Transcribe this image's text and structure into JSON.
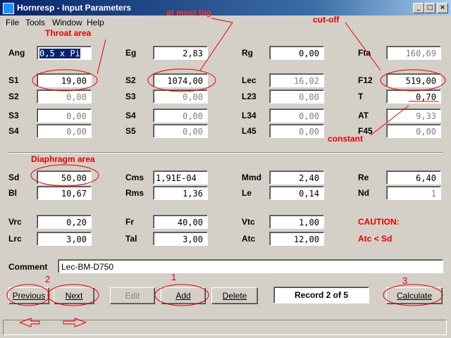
{
  "window": {
    "title": "Hornresp - Input Parameters",
    "controls": [
      "_",
      "□",
      "×"
    ]
  },
  "menu": [
    "File",
    "Tools",
    "Window",
    "Help"
  ],
  "fields": {
    "Ang": "0,5 x Pi",
    "Eg": "2,83",
    "Rg": "0,00",
    "Fta": "160,69",
    "S1": "19,00",
    "S2": "1074,00",
    "Lec": "16,02",
    "F12": "519,00",
    "S2b": "0,00",
    "S3": "0,00",
    "L23": "0,00",
    "T": "0,70",
    "S3b": "0,00",
    "S4": "0,00",
    "L34": "0,00",
    "AT": "9,33",
    "S4b": "0,00",
    "S5": "0,00",
    "L45": "0,00",
    "F45": "0,00",
    "Sd": "50,00",
    "Cms": "1,91E-04",
    "Mmd": "2,40",
    "Re": "6,40",
    "Bl": "10,67",
    "Rms": "1,36",
    "Le": "0,14",
    "Nd": "1",
    "Vrc": "0,20",
    "Fr": "40,00",
    "Vtc": "1,00",
    "Lrc": "3,00",
    "Tal": "3,00",
    "Atc": "12,00"
  },
  "labels": {
    "Ang": "Ang",
    "Eg": "Eg",
    "Rg": "Rg",
    "Fta": "Fta",
    "S1": "S1",
    "S2": "S2",
    "Lec": "Lec",
    "F12": "F12",
    "S2b": "S2",
    "S3": "S3",
    "L23": "L23",
    "T": "T",
    "S3b": "S3",
    "S4": "S4",
    "L34": "L34",
    "AT": "AT",
    "S4b": "S4",
    "S5": "S5",
    "L45": "L45",
    "F45": "F45",
    "Sd": "Sd",
    "Cms": "Cms",
    "Mmd": "Mmd",
    "Re": "Re",
    "Bl": "Bl",
    "Rms": "Rms",
    "Le": "Le",
    "Nd": "Nd",
    "Vrc": "Vrc",
    "Fr": "Fr",
    "Vtc": "Vtc",
    "Lrc": "Lrc",
    "Tal": "Tal",
    "Atc": "Atc"
  },
  "caution": {
    "title": "CAUTION:",
    "text": "Atc < Sd"
  },
  "comment": {
    "label": "Comment",
    "value": "Lec-BM-D750"
  },
  "buttons": {
    "previous": "Previous",
    "next": "Next",
    "edit": "Edit",
    "add": "Add",
    "delete": "Delete",
    "calculate": "Calculate"
  },
  "record": "Record 2 of 5",
  "annotations": {
    "throat": "Throat area",
    "atmost": "at most big",
    "cutoff": "cut-off",
    "constant": "constant",
    "diaphragm": "Diaphragm area",
    "n1": "1",
    "n2": "2",
    "n3": "3"
  },
  "colors": {
    "annotation": "#e00000",
    "titlebar": "#0a246a",
    "face": "#d4d0c8"
  }
}
